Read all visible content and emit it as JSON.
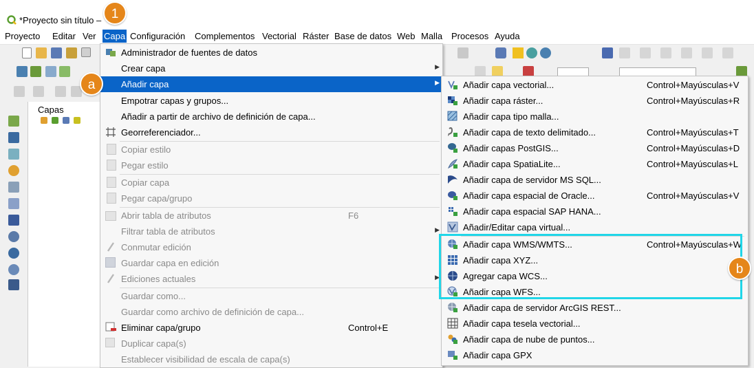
{
  "window": {
    "title": "*Proyecto sin título –"
  },
  "menubar": [
    "Proyecto",
    "Editar",
    "Ver",
    "Capa",
    "Configuración",
    "Complementos",
    "Vectorial",
    "Ráster",
    "Base de datos",
    "Web",
    "Malla",
    "Procesos",
    "Ayuda"
  ],
  "layers_panel": {
    "title": "Capas"
  },
  "layer_menu": {
    "admin": "Administrador de fuentes de datos",
    "create": "Crear capa",
    "add": "Añadir capa",
    "embed": "Empotrar capas y grupos...",
    "add_def": "Añadir a partir de archivo de definición de capa...",
    "georef": "Georreferenciador...",
    "copy_style": "Copiar estilo",
    "paste_style": "Pegar estilo",
    "copy_layer": "Copiar capa",
    "paste_layer": "Pegar capa/grupo",
    "open_attr": "Abrir tabla de atributos",
    "open_attr_sc": "F6",
    "filter_attr": "Filtrar tabla de atributos",
    "toggle_edit": "Conmutar edición",
    "save_edit": "Guardar capa en edición",
    "current_edits": "Ediciones actuales",
    "save_as": "Guardar como...",
    "save_def": "Guardar como archivo de definición de capa...",
    "remove": "Eliminar capa/grupo",
    "remove_sc": "Control+E",
    "duplicate": "Duplicar capa(s)",
    "scale_vis": "Establecer visibilidad de escala de capa(s)"
  },
  "add_submenu": [
    {
      "label": "Añadir capa vectorial...",
      "shortcut": "Control+Mayúsculas+V"
    },
    {
      "label": "Añadir capa ráster...",
      "shortcut": "Control+Mayúsculas+R"
    },
    {
      "label": "Añadir capa tipo malla...",
      "shortcut": ""
    },
    {
      "label": "Añadir capa de texto delimitado...",
      "shortcut": "Control+Mayúsculas+T"
    },
    {
      "label": "Añadir capas PostGIS...",
      "shortcut": "Control+Mayúsculas+D"
    },
    {
      "label": "Añadir capa SpatiaLite...",
      "shortcut": "Control+Mayúsculas+L"
    },
    {
      "label": "Añadir capa de servidor MS SQL...",
      "shortcut": ""
    },
    {
      "label": "Añadir capa espacial de Oracle...",
      "shortcut": "Control+Mayúsculas+V"
    },
    {
      "label": "Añadir capa espacial SAP HANA...",
      "shortcut": ""
    },
    {
      "label": "Añadir/Editar capa virtual...",
      "shortcut": ""
    },
    {
      "label": "Añadir capa WMS/WMTS...",
      "shortcut": "Control+Mayúsculas+W"
    },
    {
      "label": "Añadir capa XYZ...",
      "shortcut": ""
    },
    {
      "label": "Agregar capa WCS...",
      "shortcut": ""
    },
    {
      "label": "Añadir capa WFS...",
      "shortcut": ""
    },
    {
      "label": "Añadir capa de servidor ArcGIS REST...",
      "shortcut": ""
    },
    {
      "label": "Añadir capa tesela vectorial...",
      "shortcut": ""
    },
    {
      "label": "Añadir capa de nube de puntos...",
      "shortcut": ""
    },
    {
      "label": "Añadir capa GPX",
      "shortcut": ""
    }
  ],
  "badges": {
    "one": "1",
    "a": "a",
    "b": "b"
  },
  "colors": {
    "highlight": "#0a64c8",
    "callout": "#20d6e8",
    "badge": "#e5861a"
  }
}
